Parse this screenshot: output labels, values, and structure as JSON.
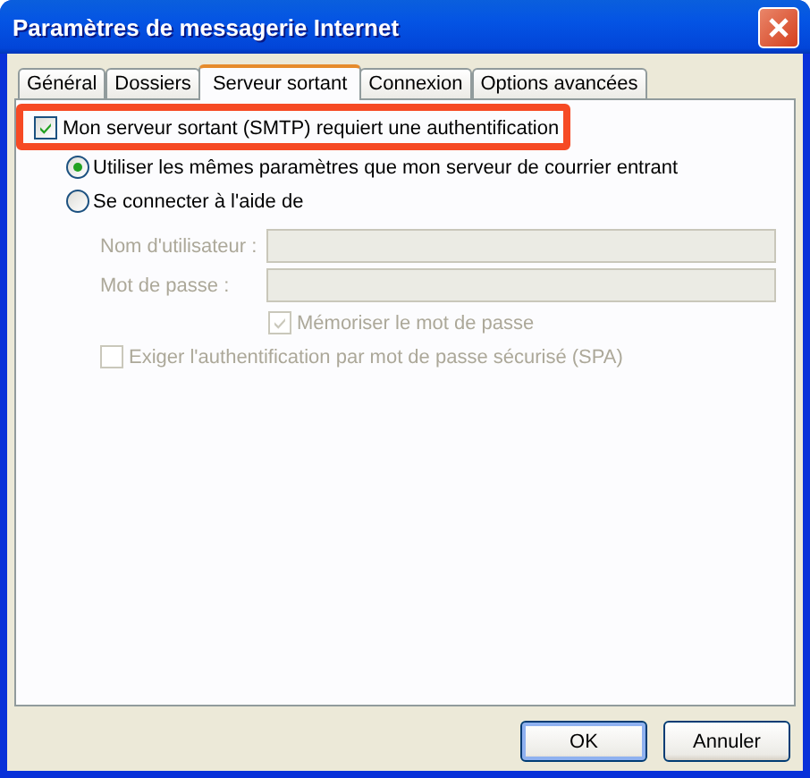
{
  "window": {
    "title": "Paramètres de messagerie Internet"
  },
  "tabs": [
    {
      "label": "Général",
      "selected": false
    },
    {
      "label": "Dossiers",
      "selected": false
    },
    {
      "label": "Serveur sortant",
      "selected": true
    },
    {
      "label": "Connexion",
      "selected": false
    },
    {
      "label": "Options avancées",
      "selected": false
    }
  ],
  "auth": {
    "label": "Mon serveur sortant (SMTP) requiert une authentification",
    "checked": true,
    "highlighted": true,
    "children": [
      {
        "label": "Utiliser les mêmes paramètres que mon serveur de courrier entrant",
        "selected": true
      },
      {
        "label": "Se connecter à l'aide de",
        "selected": false,
        "children": [
          {
            "kind": "field",
            "label": "Nom d'utilisateur :",
            "disabled": true
          },
          {
            "kind": "field",
            "label": "Mot de passe :",
            "disabled": true
          },
          {
            "kind": "field-checkbox",
            "label": "Mémoriser le mot de passe",
            "checked": true,
            "disabled": true
          },
          {
            "kind": "checkbox",
            "label": "Exiger l'authentification par mot de passe sécurisé (SPA)",
            "checked": false,
            "disabled": true
          }
        ]
      }
    ]
  },
  "buttons": [
    {
      "label": "OK",
      "default": true
    },
    {
      "label": "Annuler",
      "default": false
    }
  ]
}
